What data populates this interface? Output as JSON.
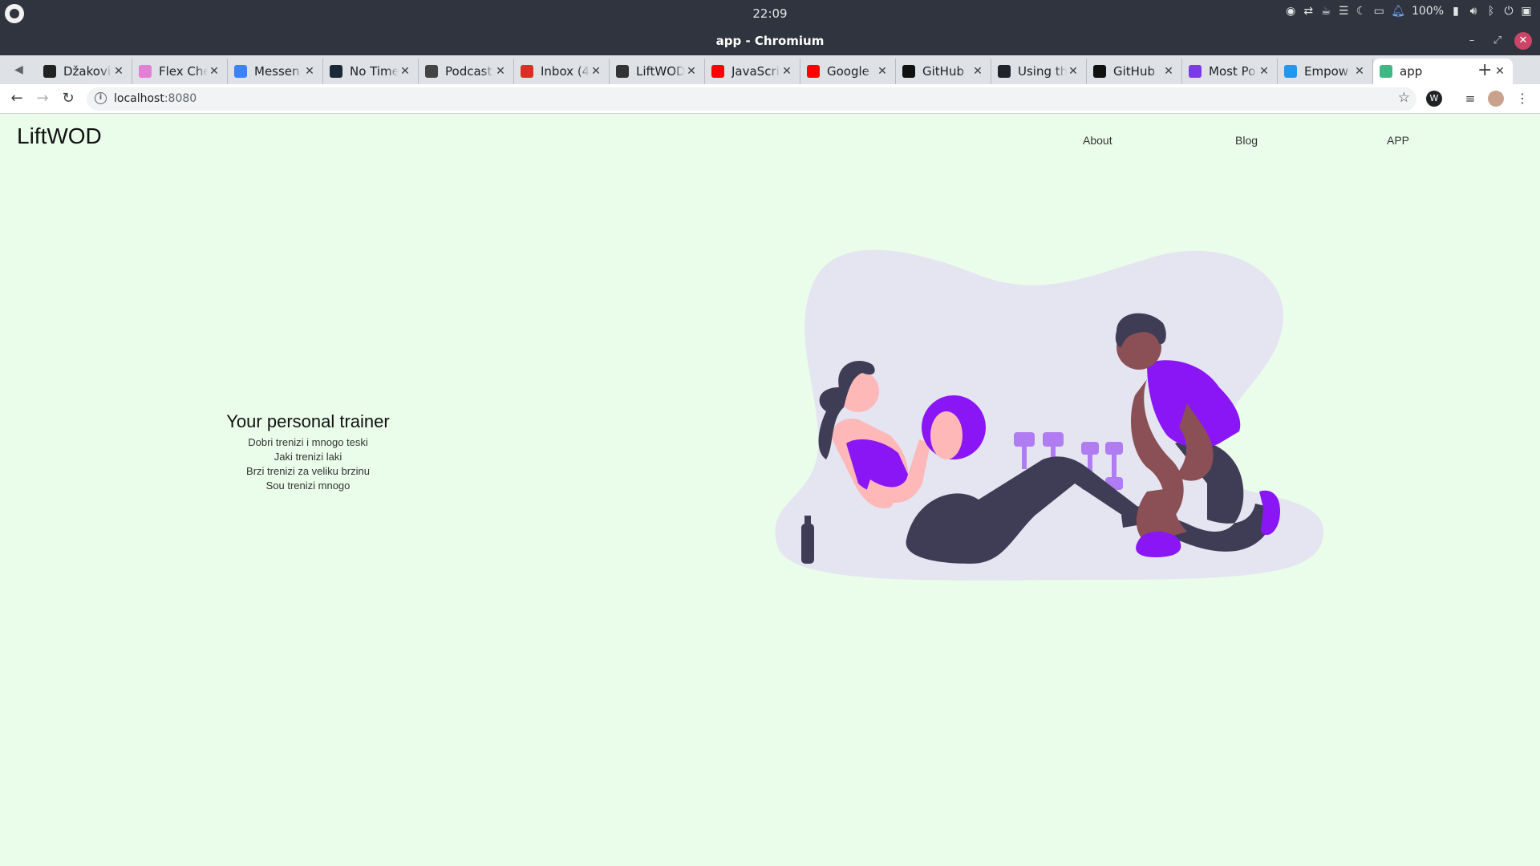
{
  "os": {
    "clock": "22:09",
    "battery": "100%"
  },
  "window": {
    "title": "app - Chromium"
  },
  "tabs": [
    {
      "label": "Džakovi",
      "icon": "peak-icon",
      "color": "#222222"
    },
    {
      "label": "Flex Che",
      "icon": "ring-icon",
      "color": "#e57fd6"
    },
    {
      "label": "Messen",
      "icon": "messenger-icon",
      "color": "#3b82f6"
    },
    {
      "label": "No Time",
      "icon": "steam-icon",
      "color": "#1b2838"
    },
    {
      "label": "Podcast",
      "icon": "podcast-icon",
      "color": "#444444"
    },
    {
      "label": "Inbox (4",
      "icon": "gmail-icon",
      "color": "#d93025"
    },
    {
      "label": "LiftWOD",
      "icon": "liftwod-icon",
      "color": "#333333"
    },
    {
      "label": "JavaScri",
      "icon": "youtube-icon",
      "color": "#ff0000"
    },
    {
      "label": "Google",
      "icon": "youtube-icon",
      "color": "#ff0000"
    },
    {
      "label": "GitHub",
      "icon": "github-icon",
      "color": "#111111"
    },
    {
      "label": "Using th",
      "icon": "react-icon",
      "color": "#20232a"
    },
    {
      "label": "GitHub",
      "icon": "github-icon",
      "color": "#111111"
    },
    {
      "label": "Most Po",
      "icon": "crescent-icon",
      "color": "#7c3aed"
    },
    {
      "label": "Empow",
      "icon": "docker-icon",
      "color": "#2496ed"
    },
    {
      "label": "app",
      "icon": "vue-icon",
      "color": "#41b883"
    }
  ],
  "omnibox": {
    "host": "localhost",
    "port": ":8080"
  },
  "page": {
    "brand": "LiftWOD",
    "nav": [
      "About",
      "Blog",
      "APP"
    ],
    "hero_title": "Your personal trainer",
    "hero_lines": [
      "Dobri trenizi i mnogo teski",
      "Jaki trenizi laki",
      "Brzi trenizi za veliku brzinu",
      "Sou trenizi mnogo"
    ]
  },
  "colors": {
    "page_bg": "#eafdea",
    "accent_purple": "#8a16f5",
    "blob": "#e4e5f1"
  }
}
